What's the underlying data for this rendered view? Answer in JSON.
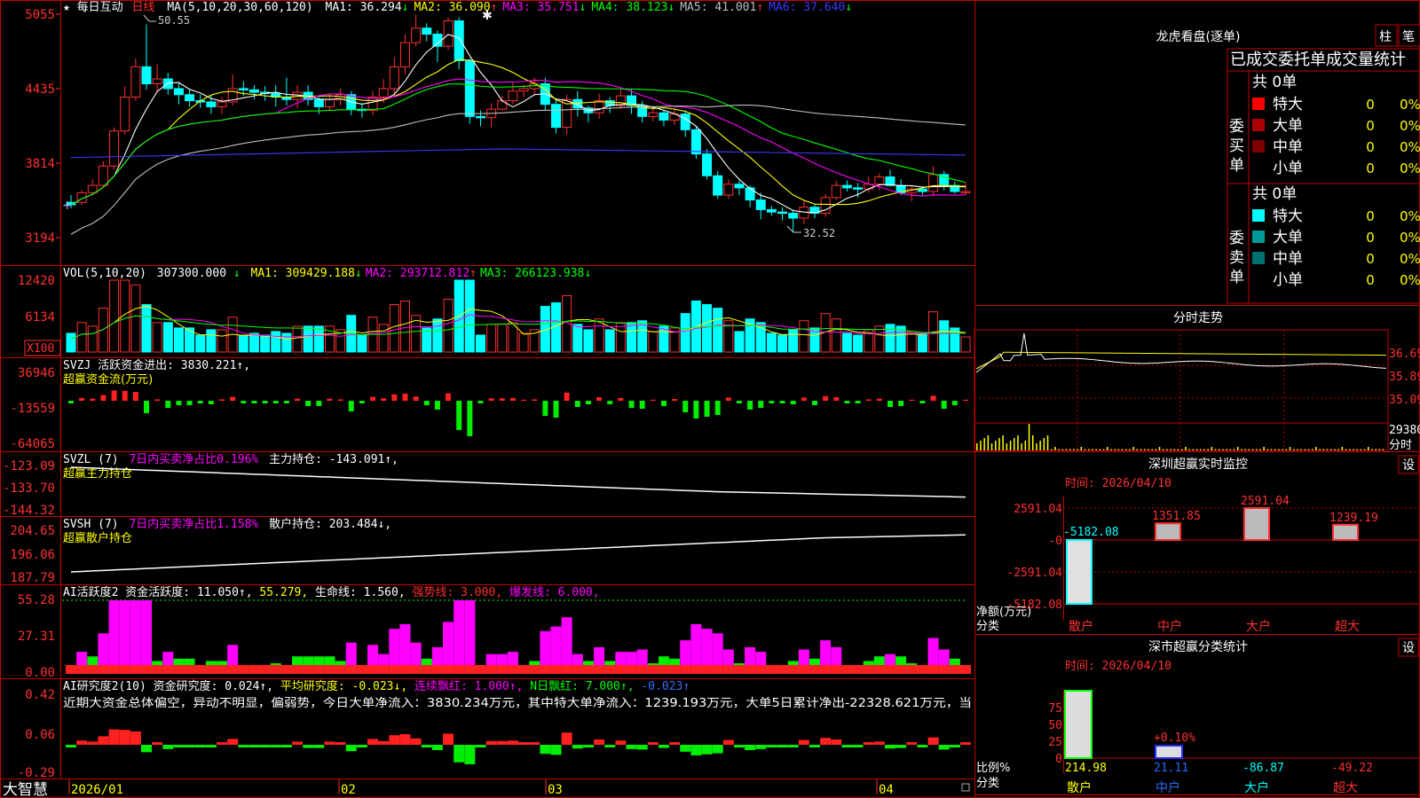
{
  "app": {
    "brand": "大智慧"
  },
  "stock": {
    "name": "每日互动",
    "period": "日线"
  },
  "main_chart": {
    "ma_params": "MA(5,10,20,30,60,120)",
    "ma": [
      {
        "label": "MA1:",
        "value": "36.294",
        "arrow": "↓",
        "color": "#ffffff"
      },
      {
        "label": "MA2:",
        "value": "36.090",
        "arrow": "↑",
        "color": "#ffff00"
      },
      {
        "label": "MA3:",
        "value": "35.751",
        "arrow": "↓",
        "color": "#ff00ff"
      },
      {
        "label": "MA4:",
        "value": "38.123",
        "arrow": "↓",
        "color": "#00ff00"
      },
      {
        "label": "MA5:",
        "value": "41.001",
        "arrow": "↑",
        "color": "#c0c0c0"
      },
      {
        "label": "MA6:",
        "value": "37.640",
        "arrow": "↓",
        "color": "#3a3aff"
      }
    ],
    "y_ticks": [
      "5055",
      "4435",
      "3814",
      "3194"
    ],
    "high_label": "50.55",
    "low_label": "32.52"
  },
  "panels": {
    "vol": {
      "params": "VOL(5,10,20)",
      "main_value": "307300.000",
      "main_arrow": "↓",
      "items": [
        {
          "label": "MA1:",
          "value": "309429.188",
          "arrow": "↓",
          "color": "#ffff00"
        },
        {
          "label": "MA2:",
          "value": "293712.812",
          "arrow": "↑",
          "color": "#ff00ff"
        },
        {
          "label": "MA3:",
          "value": "266123.938",
          "arrow": "↓",
          "color": "#00ff00"
        }
      ],
      "y_ticks": [
        "12420",
        "6134"
      ],
      "unit": "X100"
    },
    "svzj": {
      "line": "SVZJ  活跃资金进出: 3830.221↑,",
      "subtitle": "超赢资金流(万元)",
      "y_ticks": [
        "36946",
        "-13559",
        "-64065"
      ]
    },
    "svzl": {
      "line1": "SVZL (7)",
      "line2": "7日内买卖净占比0.196%",
      "line3": "主力持仓: -143.091↑,",
      "subtitle": "超赢主力持仓",
      "y_ticks": [
        "-123.09",
        "-133.70",
        "-144.32"
      ]
    },
    "svsh": {
      "line1": "SVSH (7)",
      "line2": "7日内买卖净占比1.158%",
      "line3": "散户持仓: 203.484↓,",
      "subtitle": "超赢散户持仓",
      "y_ticks": [
        "204.65",
        "196.06",
        "187.79"
      ]
    },
    "ai1": {
      "parts": [
        {
          "text": "AI活跃度2 资金活跃度: 11.050↑, ",
          "color": "#ffffff"
        },
        {
          "text": "55.279, ",
          "color": "#ffff00"
        },
        {
          "text": "生命线: 1.560, ",
          "color": "#ffffff"
        },
        {
          "text": "强势线: 3.000, ",
          "color": "#ff3030"
        },
        {
          "text": "爆发线: 6.000,",
          "color": "#ff00ff"
        }
      ],
      "y_ticks": [
        "55.28",
        "27.31",
        "0.00"
      ]
    },
    "ai2": {
      "parts": [
        {
          "text": "AI研究度2(10) 资金研究度: 0.024↑, ",
          "color": "#ffffff"
        },
        {
          "text": "平均研究度: -0.023↓, ",
          "color": "#ffff00"
        },
        {
          "text": "连续飘红: 1.000↑, ",
          "color": "#ff00ff"
        },
        {
          "text": "N日飘红: 7.000↑, ",
          "color": "#00ff00"
        },
        {
          "text": "-0.023↑",
          "color": "#3a6bff"
        }
      ],
      "description": "近期大资金总体偏空，异动不明显，偏弱势，今日大单净流入：3830.234万元，其中特大单净流入：1239.193万元，大单5日累计净出-22328.621万元，当",
      "y_ticks": [
        "0.42",
        "0.06",
        "-0.29"
      ]
    }
  },
  "x_axis": {
    "labels": [
      "2026/01",
      "02",
      "03",
      "04"
    ]
  },
  "right_panel": {
    "longhu": {
      "title": "龙虎看盘(逐单)",
      "tab1": "柱",
      "tab2": "笔",
      "header": "已成交委托单成交量统计",
      "buy": {
        "side_label": "委买单",
        "total": "共 0单",
        "rows": [
          {
            "label": "特大",
            "count": "0",
            "pct": "0%",
            "color": "#ff0000"
          },
          {
            "label": "大单",
            "count": "0",
            "pct": "0%",
            "color": "#aa0000"
          },
          {
            "label": "中单",
            "count": "0",
            "pct": "0%",
            "color": "#800000"
          },
          {
            "label": "小单",
            "count": "0",
            "pct": "0%",
            "color": ""
          }
        ]
      },
      "sell": {
        "side_label": "委卖单",
        "total": "共 0单",
        "rows": [
          {
            "label": "特大",
            "count": "0",
            "pct": "0%",
            "color": "#00ffff"
          },
          {
            "label": "大单",
            "count": "0",
            "pct": "0%",
            "color": "#009a9a"
          },
          {
            "label": "中单",
            "count": "0",
            "pct": "0%",
            "color": "#007070"
          },
          {
            "label": "小单",
            "count": "0",
            "pct": "0%",
            "color": ""
          }
        ]
      }
    },
    "intraday": {
      "title": "分时走势",
      "price_labels": [
        "36.69",
        "35.89",
        "35.09"
      ],
      "vol_label": "29380",
      "fen_label": "分时"
    },
    "monitor": {
      "title": "深圳超赢实时监控",
      "settings": "设",
      "time": "时间: 2026/04/10",
      "y_ticks": [
        "2591.04",
        "-0",
        "-2591.04",
        "-5182.08"
      ],
      "y_unit_1": "净额(万元)",
      "y_unit_2": "分类",
      "bar_values": [
        -5182.08,
        1351.85,
        2591.04,
        1239.19
      ],
      "bar_labels": [
        "-5182.08",
        "1351.85",
        "2591.04",
        "1239.19"
      ],
      "categories": [
        "散户",
        "中户",
        "大户",
        "超大"
      ]
    },
    "classify": {
      "title": "深市超赢分类统计",
      "settings": "设",
      "time": "时间: 2026/04/10",
      "y_ticks": [
        "75",
        "50",
        "25",
        "0"
      ],
      "y_unit_1": "比例%",
      "y_unit_2": "分类",
      "mid_label": "+0.10%",
      "values": [
        "214.98",
        "21.11",
        "-86.87",
        "-49.22"
      ],
      "categories": [
        "散户",
        "中户",
        "大户",
        "超大"
      ]
    }
  },
  "chart_data": {
    "type": "candlestick",
    "title": "每日互动 日线",
    "ylim": [
      31.94,
      50.55
    ],
    "candles": [
      [
        35.0,
        34.8,
        35.6,
        34.5
      ],
      [
        35.0,
        35.8,
        36.0,
        34.8
      ],
      [
        35.8,
        36.4,
        36.9,
        35.6
      ],
      [
        36.4,
        38.0,
        38.4,
        36.2
      ],
      [
        38.0,
        40.9,
        41.2,
        37.7
      ],
      [
        40.9,
        43.7,
        44.6,
        40.6
      ],
      [
        43.7,
        46.2,
        46.9,
        43.4
      ],
      [
        46.2,
        44.8,
        49.7,
        44.3
      ],
      [
        44.8,
        45.2,
        46.4,
        44.1
      ],
      [
        45.2,
        44.4,
        45.7,
        43.9
      ],
      [
        44.4,
        43.9,
        44.9,
        43.1
      ],
      [
        43.9,
        43.4,
        44.4,
        42.9
      ],
      [
        43.4,
        43.3,
        43.9,
        42.8
      ],
      [
        43.3,
        42.9,
        43.8,
        42.3
      ],
      [
        42.9,
        43.3,
        43.7,
        42.3
      ],
      [
        43.3,
        44.4,
        45.6,
        43.0
      ],
      [
        44.4,
        44.3,
        45.0,
        43.8
      ],
      [
        44.3,
        44.1,
        44.7,
        43.5
      ],
      [
        44.1,
        44.0,
        44.6,
        43.4
      ],
      [
        44.0,
        43.7,
        44.7,
        42.9
      ],
      [
        43.7,
        43.5,
        45.3,
        43.0
      ],
      [
        43.5,
        44.1,
        44.7,
        42.8
      ],
      [
        44.1,
        43.5,
        44.7,
        43.0
      ],
      [
        43.5,
        42.9,
        43.7,
        42.3
      ],
      [
        42.9,
        43.5,
        44.0,
        42.6
      ],
      [
        43.5,
        43.9,
        44.4,
        43.0
      ],
      [
        43.9,
        42.7,
        44.2,
        42.2
      ],
      [
        42.7,
        42.6,
        43.2,
        42.0
      ],
      [
        42.6,
        43.7,
        44.2,
        42.2
      ],
      [
        43.7,
        44.4,
        45.2,
        43.2
      ],
      [
        44.4,
        46.2,
        47.0,
        43.7
      ],
      [
        46.2,
        48.2,
        48.9,
        45.6
      ],
      [
        48.2,
        49.4,
        50.5,
        47.9
      ],
      [
        49.4,
        48.9,
        49.8,
        48.3
      ],
      [
        48.9,
        47.9,
        49.2,
        46.6
      ],
      [
        47.9,
        50.0,
        50.3,
        47.6
      ],
      [
        50.0,
        46.7,
        50.3,
        46.0
      ],
      [
        46.7,
        42.1,
        46.9,
        41.5
      ],
      [
        42.1,
        42.0,
        42.6,
        41.3
      ],
      [
        42.0,
        42.7,
        43.2,
        41.2
      ],
      [
        42.7,
        43.4,
        43.8,
        42.6
      ],
      [
        43.4,
        44.2,
        44.9,
        43.1
      ],
      [
        44.2,
        44.4,
        44.7,
        43.7
      ],
      [
        44.4,
        44.8,
        45.3,
        43.9
      ],
      [
        44.8,
        43.1,
        45.3,
        42.6
      ],
      [
        43.1,
        41.2,
        43.4,
        40.7
      ],
      [
        41.2,
        43.5,
        43.9,
        40.6
      ],
      [
        43.5,
        42.8,
        44.2,
        42.1
      ],
      [
        42.8,
        42.4,
        43.0,
        41.6
      ],
      [
        42.4,
        43.4,
        44.0,
        41.9
      ],
      [
        43.4,
        43.0,
        43.7,
        42.4
      ],
      [
        43.0,
        43.8,
        44.4,
        42.7
      ],
      [
        43.8,
        43.0,
        44.3,
        42.3
      ],
      [
        43.0,
        42.1,
        43.4,
        41.6
      ],
      [
        42.1,
        42.4,
        42.9,
        41.7
      ],
      [
        42.4,
        41.8,
        42.6,
        41.3
      ],
      [
        41.8,
        42.3,
        42.8,
        41.4
      ],
      [
        42.3,
        41.0,
        42.6,
        40.4
      ],
      [
        41.0,
        39.0,
        41.3,
        38.6
      ],
      [
        39.0,
        37.2,
        39.4,
        36.9
      ],
      [
        37.2,
        35.6,
        37.6,
        35.3
      ],
      [
        35.6,
        36.5,
        36.9,
        35.3
      ],
      [
        36.5,
        36.2,
        36.8,
        35.6
      ],
      [
        36.2,
        35.2,
        36.4,
        34.6
      ],
      [
        35.2,
        34.4,
        35.8,
        33.6
      ],
      [
        34.4,
        34.2,
        34.7,
        33.9
      ],
      [
        34.2,
        34.1,
        34.6,
        33.5
      ],
      [
        34.1,
        33.7,
        34.4,
        32.5
      ],
      [
        33.7,
        34.6,
        35.2,
        33.2
      ],
      [
        34.6,
        34.1,
        34.9,
        33.7
      ],
      [
        34.1,
        35.4,
        35.7,
        33.8
      ],
      [
        35.4,
        36.4,
        36.8,
        35.2
      ],
      [
        36.4,
        36.2,
        36.8,
        35.9
      ],
      [
        36.2,
        36.1,
        36.6,
        35.4
      ],
      [
        36.1,
        36.5,
        37.1,
        35.8
      ],
      [
        36.5,
        37.1,
        37.4,
        36.0
      ],
      [
        37.1,
        36.4,
        37.7,
        36.3
      ],
      [
        36.4,
        35.8,
        36.9,
        35.6
      ],
      [
        35.8,
        36.1,
        36.4,
        35.1
      ],
      [
        36.1,
        35.9,
        36.3,
        35.6
      ],
      [
        35.9,
        37.3,
        38.0,
        35.5
      ],
      [
        37.3,
        36.4,
        37.6,
        36.0
      ],
      [
        36.4,
        35.9,
        36.7,
        35.7
      ],
      [
        35.9,
        35.9,
        36.6,
        35.6
      ]
    ]
  }
}
